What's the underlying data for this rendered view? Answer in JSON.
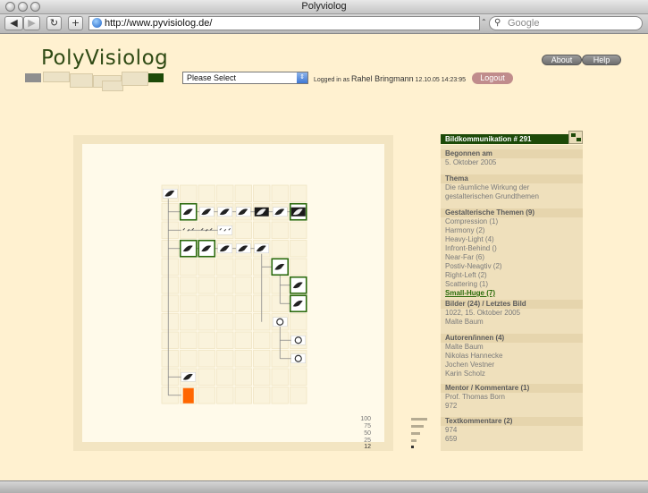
{
  "window": {
    "title": "Polyviolog"
  },
  "toolbar": {
    "back_icon": "back-arrow-icon",
    "forward_icon": "forward-arrow-icon",
    "reload_icon": "reload-icon",
    "add_icon": "plus-icon",
    "url": "http://www.pyvisiolog.de/",
    "search_placeholder": "Google"
  },
  "header": {
    "logo": "PolyVisiolog",
    "select_value": "Please Select",
    "logged_in_label": "Logged in as",
    "user_name": "Rahel Bringmann",
    "login_time": "12.10.05 14:23:95",
    "logout_label": "Logout",
    "about_label": "About",
    "help_label": "Help"
  },
  "legend": [
    "100",
    "75",
    "50",
    "25",
    "12"
  ],
  "panel": {
    "title": "Bildkommunikation # 291",
    "sections": [
      {
        "heading": "Begonnen am",
        "lines": [
          "5. Oktober 2005"
        ]
      },
      {
        "heading": "Thema",
        "lines": [
          "Die räumliche Wirkung der",
          "gestalterischen Grundthemen"
        ]
      },
      {
        "heading": "Gestalterische Themen (9)",
        "lines": [
          "Compression (1)",
          "Harmony (2)",
          "Heavy-Light (4)",
          "Infront-Behind ()",
          "Near-Far (6)",
          "Postiv-Neagtiv (2)",
          "Right-Left (2)",
          "Scattering (1)",
          "Small-Huge (7)"
        ],
        "selected": 8
      },
      {
        "heading": "Bilder (24) / Letztes Bild",
        "lines": [
          "1022, 15. Oktober 2005",
          "Malte Baum"
        ]
      },
      {
        "heading": "Autoren/innen (4)",
        "lines": [
          "Malte Baum",
          "Nikolas Hannecke",
          "Jochen Vestner",
          "Karin Scholz"
        ]
      },
      {
        "heading": "Mentor / Kommentare (1)",
        "lines": [
          "Prof. Thomas Born",
          "972"
        ]
      },
      {
        "heading": "Textkommentare (2)",
        "lines": [
          "974",
          "659"
        ]
      }
    ]
  },
  "colors": {
    "accent": "#1d4a08",
    "logout": "#c08c8c",
    "selected_node": "#ff6600",
    "background": "#fff1d0"
  }
}
